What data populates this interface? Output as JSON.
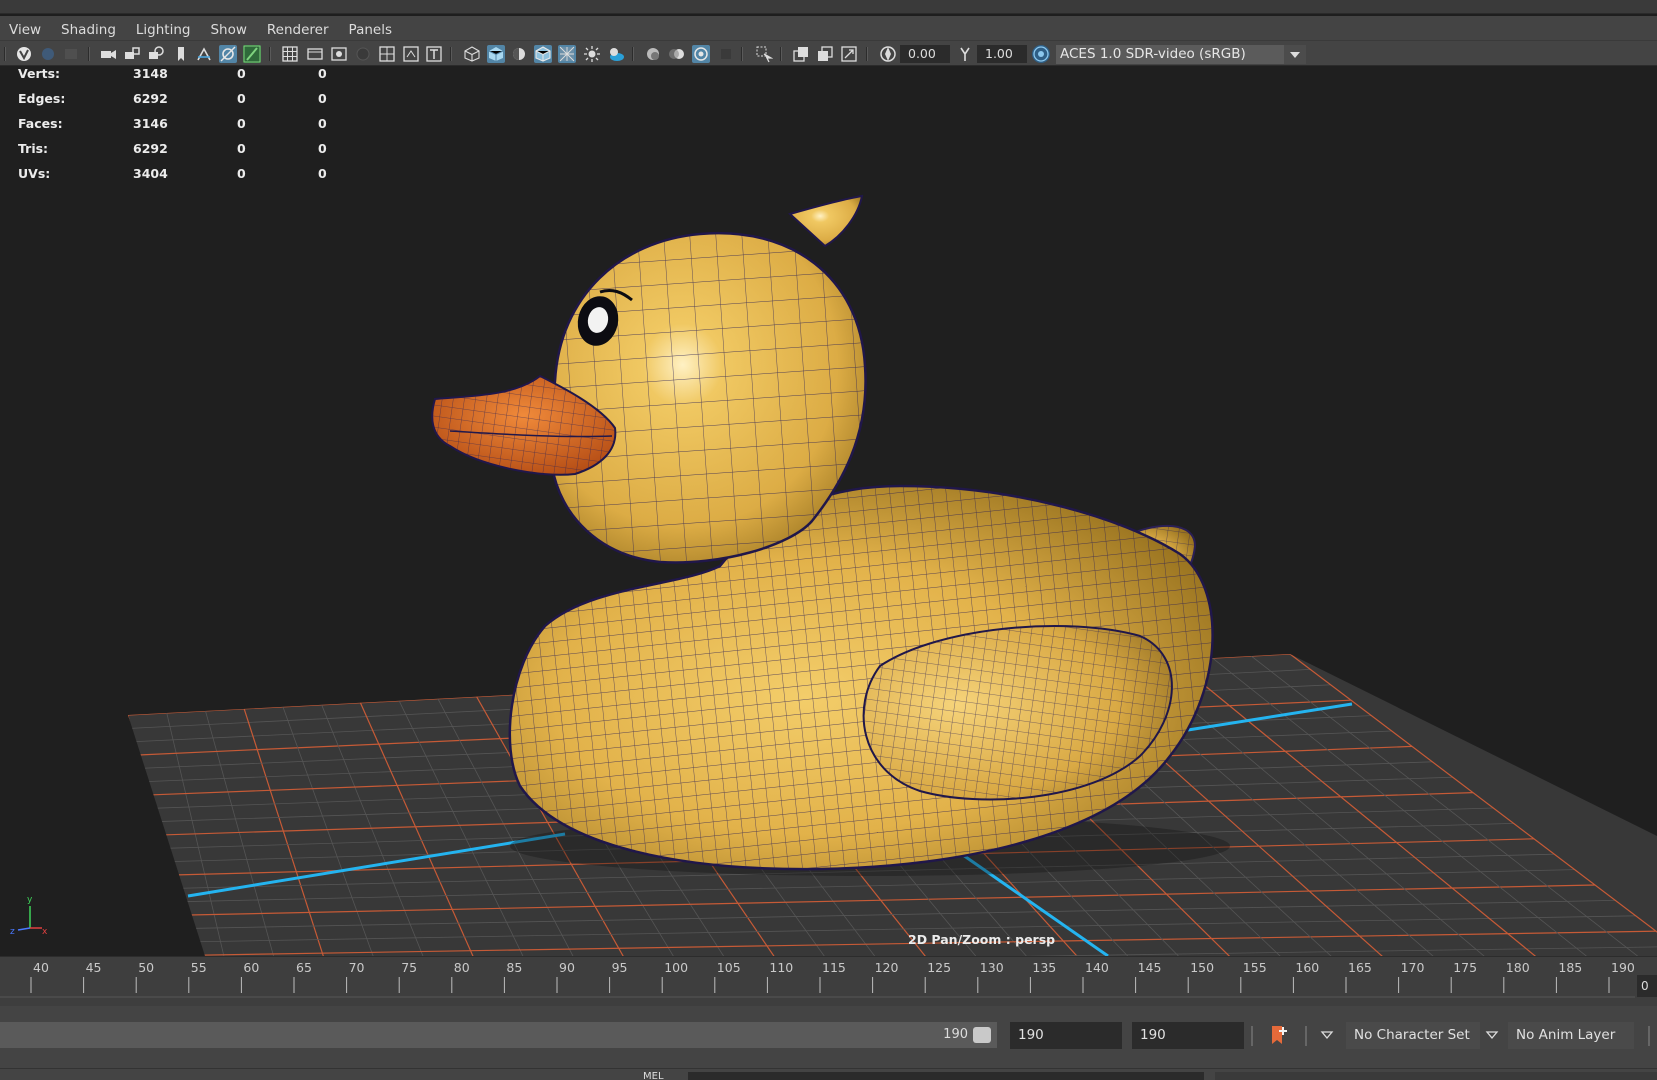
{
  "panel_menu": [
    "View",
    "Shading",
    "Lighting",
    "Show",
    "Renderer",
    "Panels"
  ],
  "toolbar": {
    "exposure_value": "0.00",
    "gamma_value": "1.00",
    "color_transform": "ACES 1.0 SDR-video (sRGB)"
  },
  "hud": {
    "rows": [
      {
        "label": "Verts:",
        "values": [
          "3148",
          "0",
          "0"
        ]
      },
      {
        "label": "Edges:",
        "values": [
          "6292",
          "0",
          "0"
        ]
      },
      {
        "label": "Faces:",
        "values": [
          "3146",
          "0",
          "0"
        ]
      },
      {
        "label": "Tris:",
        "values": [
          "6292",
          "0",
          "0"
        ]
      },
      {
        "label": "UVs:",
        "values": [
          "3404",
          "0",
          "0"
        ]
      }
    ]
  },
  "viewport": {
    "camera_label": "2D Pan/Zoom : persp",
    "axis_labels": [
      "y",
      "z",
      "x"
    ]
  },
  "timeline": {
    "tick_labels": [
      "40",
      "45",
      "50",
      "55",
      "60",
      "65",
      "70",
      "75",
      "80",
      "85",
      "90",
      "95",
      "100",
      "105",
      "110",
      "115",
      "120",
      "125",
      "130",
      "135",
      "140",
      "145",
      "150",
      "155",
      "160",
      "165",
      "170",
      "175",
      "180",
      "185",
      "190"
    ],
    "current_frame": "0"
  },
  "range": {
    "slider_end": "190",
    "playback_end": "190",
    "animation_end": "190",
    "character_set": "No Character Set",
    "anim_layer": "No Anim Layer"
  },
  "command_line": {
    "mode_label": "MEL"
  },
  "colors": {
    "background": "#1f1f1f",
    "panel": "#444444",
    "active_icon": "#5285a6",
    "grid_axis": "#24b4f0",
    "grid_lines": "#c65a36",
    "duck_body": "#e8b94e",
    "duck_beak": "#e06a20",
    "wireframe": "#2a1f55"
  }
}
